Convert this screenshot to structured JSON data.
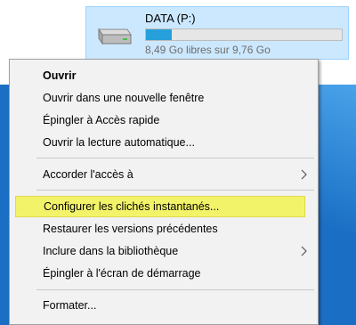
{
  "drive": {
    "name": "DATA (P:)",
    "free_text": "8,49 Go libres sur 9,76 Go",
    "used_fraction": 0.13,
    "icon": "drive-icon"
  },
  "menu": {
    "items": [
      {
        "label": "Ouvrir"
      },
      {
        "label": "Ouvrir dans une nouvelle fenêtre"
      },
      {
        "label": "Épingler à Accès rapide"
      },
      {
        "label": "Ouvrir la lecture automatique..."
      },
      {
        "label": "Accorder l'accès à"
      },
      {
        "label": "Configurer les clichés instantanés..."
      },
      {
        "label": "Restaurer les versions précédentes"
      },
      {
        "label": "Inclure dans la bibliothèque"
      },
      {
        "label": "Épingler à l'écran de démarrage"
      },
      {
        "label": "Formater..."
      }
    ]
  },
  "colors": {
    "highlight": "#f3f36a",
    "selection": "#cce8ff",
    "desktop": "#1a6fc4"
  }
}
